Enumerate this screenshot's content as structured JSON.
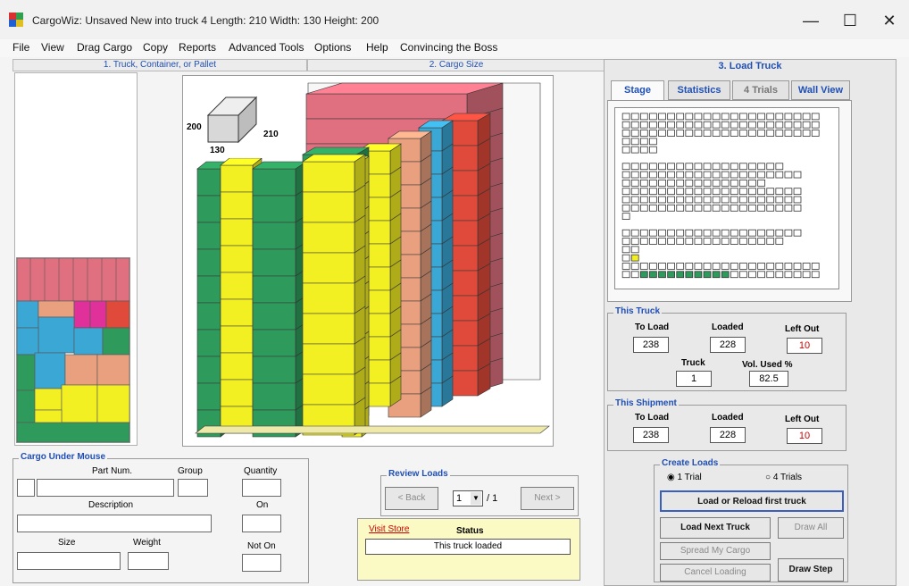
{
  "window": {
    "title": "CargoWiz:  Unsaved New into  truck 4   Length: 210   Width: 130   Height: 200",
    "minimize": "—",
    "maximize": "☐",
    "close": "✕"
  },
  "menu": [
    "File",
    "View",
    "Drag Cargo",
    "Copy",
    "Reports",
    "Advanced Tools",
    "Options",
    "Help",
    "Convincing the Boss"
  ],
  "panels": {
    "truck": "1. Truck, Container, or Pallet",
    "cargo": "2. Cargo Size",
    "load": "3. Load Truck"
  },
  "size_label": {
    "height": "200",
    "length": "210",
    "width": "130"
  },
  "tabs": [
    {
      "label": "Stage",
      "active": true
    },
    {
      "label": "Statistics",
      "active": false
    },
    {
      "label": "4 Trials",
      "active": false
    },
    {
      "label": "Wall View",
      "active": false
    }
  ],
  "this_truck": {
    "title": "This Truck",
    "to_load_label": "To Load",
    "to_load": "238",
    "loaded_label": "Loaded",
    "loaded": "228",
    "left_out_label": "Left Out",
    "left_out": "10",
    "truck_label": "Truck",
    "truck": "1",
    "vol_label": "Vol. Used %",
    "vol": "82.5"
  },
  "this_shipment": {
    "title": "This Shipment",
    "to_load_label": "To Load",
    "to_load": "238",
    "loaded_label": "Loaded",
    "loaded": "228",
    "left_out_label": "Left Out",
    "left_out": "10"
  },
  "create_loads": {
    "title": "Create Loads",
    "trial1": "1 Trial",
    "trial4": "4 Trials",
    "load_reload": "Load or Reload first truck",
    "load_next": "Load Next Truck",
    "draw_all": "Draw All",
    "spread": "Spread My Cargo",
    "cancel": "Cancel Loading",
    "draw_step": "Draw Step"
  },
  "cargo_under_mouse": {
    "title": "Cargo Under Mouse",
    "part_num": "Part Num.",
    "group": "Group",
    "quantity": "Quantity",
    "description": "Description",
    "on": "On",
    "size": "Size",
    "weight": "Weight",
    "not_on": "Not On"
  },
  "review_loads": {
    "title": "Review Loads",
    "back": "< Back",
    "page": "1",
    "of": "/ 1",
    "next": "Next >"
  },
  "status_box": {
    "visit_store": "Visit Store",
    "status_label": "Status",
    "status": "This truck loaded"
  },
  "colors": {
    "green": "#2e9b5c",
    "yellow": "#f2ef22",
    "pink": "#e07080",
    "salmon": "#e9a07e",
    "blue": "#3aa7d4",
    "red": "#e04a3b",
    "magenta": "#e0309a",
    "accent": "#1f4fb5"
  }
}
